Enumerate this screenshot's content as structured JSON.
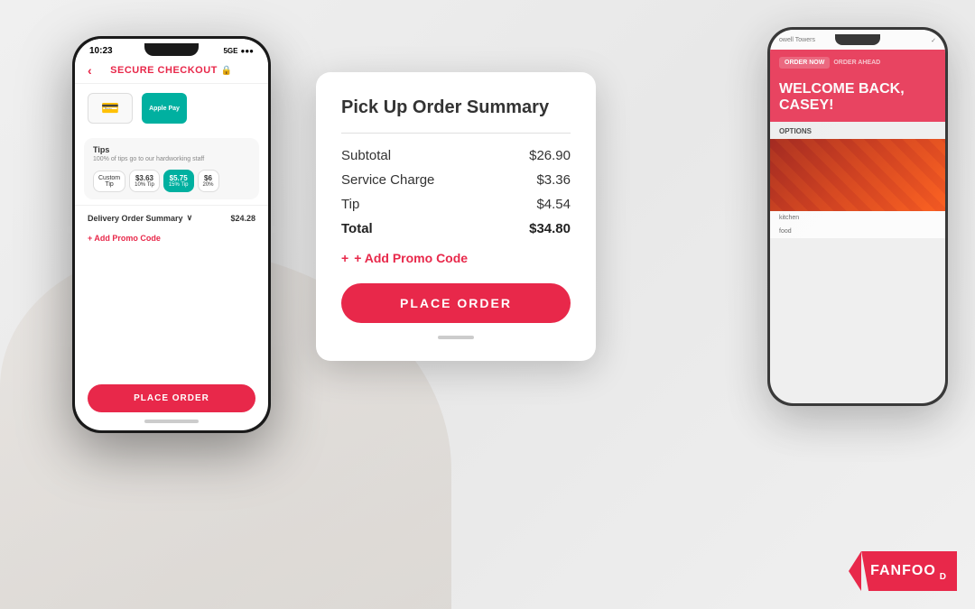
{
  "background": {
    "color": "#f0eeec"
  },
  "phone_left": {
    "status_bar": {
      "time": "10:23",
      "signal": "5GE",
      "battery": "●●●"
    },
    "header": {
      "back_label": "‹",
      "title": "SECURE CHECKOUT",
      "lock_icon": "🔒"
    },
    "payment": {
      "card_icon": "💳",
      "apple_pay_label": "Apple Pay"
    },
    "tips": {
      "title": "Tips",
      "subtitle": "100% of tips go to our hardworking staff",
      "options": [
        {
          "label": "Custom Tip",
          "amount": ""
        },
        {
          "label": "$3.63",
          "percent": "10% Tip"
        },
        {
          "label": "$5.75",
          "percent": "15% Tip",
          "active": true
        },
        {
          "label": "$6",
          "percent": "20%"
        }
      ]
    },
    "order_summary": {
      "label": "Delivery Order Summary",
      "chevron": "∨",
      "total": "$24.28"
    },
    "promo": {
      "label": "+ Add Promo Code"
    },
    "place_order": {
      "label": "PLACE ORDER"
    }
  },
  "order_card": {
    "title": "Pick Up Order Summary",
    "lines": [
      {
        "label": "Subtotal",
        "value": "$26.90"
      },
      {
        "label": "Service Charge",
        "value": "$3.36"
      },
      {
        "label": "Tip",
        "value": "$4.54"
      }
    ],
    "total": {
      "label": "Total",
      "value": "$34.80"
    },
    "promo": {
      "label": "+ Add Promo Code"
    },
    "place_order": {
      "label": "PLACE ORDER"
    }
  },
  "phone_right": {
    "header": {
      "location": "owell Towers"
    },
    "nav": {
      "order_now": "ORDER NOW",
      "order_ahead": "ORDER AHEAD"
    },
    "welcome": {
      "line1": "WELCOME BACK,",
      "line2": "CASEY!"
    },
    "options_label": "OPTIONS",
    "locations": [
      "kitchen",
      "food"
    ]
  },
  "logo": {
    "text": "FANFOO",
    "full_text": "FANFOOD"
  }
}
